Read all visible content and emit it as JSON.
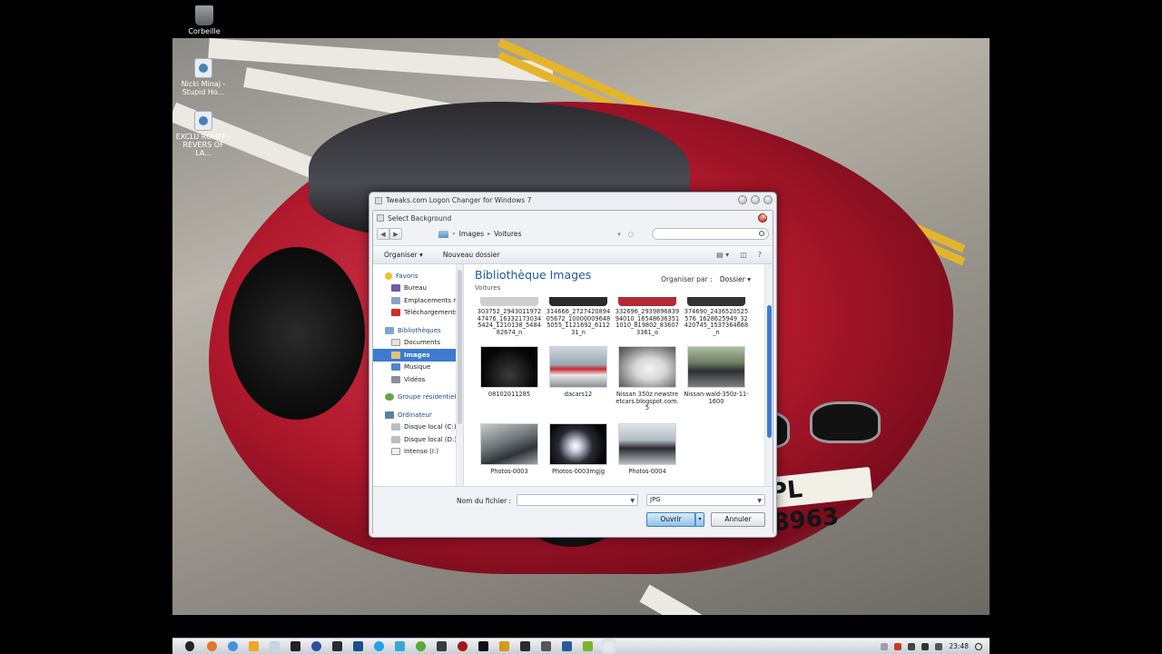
{
  "desktop": {
    "icons": [
      {
        "label": "Corbeille",
        "icon": "recycle-bin-icon"
      },
      {
        "label": "Nicki Minaj - Stupid Ho...",
        "icon": "media-file-icon"
      },
      {
        "label": "EXCLU ROHFF - REVERS OF LA...",
        "icon": "media-file-icon"
      }
    ],
    "plate_text": "PL 8963"
  },
  "outer_window": {
    "title": "Tweaks.com Logon Changer for Windows 7"
  },
  "dialog": {
    "title": "Select Background",
    "breadcrumb": [
      "Images",
      "Voitures"
    ],
    "search_placeholder": "",
    "toolbar": {
      "organize": "Organiser",
      "new_folder": "Nouveau dossier",
      "view_icon": "view-options-icon",
      "preview_icon": "preview-pane-icon",
      "help_icon": "help-icon"
    },
    "nav": {
      "favorites": {
        "label": "Favoris",
        "items": [
          "Bureau",
          "Emplacements ré",
          "Téléchargements"
        ]
      },
      "libraries": {
        "label": "Bibliothèques",
        "items": [
          "Documents",
          "Images",
          "Musique",
          "Vidéos"
        ],
        "selected": "Images"
      },
      "homegroup": {
        "label": "Groupe résidentiel"
      },
      "computer": {
        "label": "Ordinateur",
        "items": [
          "Disque local (C:)",
          "Disque local (D:)",
          "Intenso (I:)"
        ]
      }
    },
    "library": {
      "title": "Bibliothèque Images",
      "subtitle": "Voitures",
      "arrange_label": "Organiser par :",
      "arrange_value": "Dossier"
    },
    "files_row1": [
      "303752_294301197247476_163321730345424_1210138_548482674_n",
      "314666_272742089405672_100000096485055_1121692_611231_n",
      "332696_293989683994010_165486363511010_819802_836073361_o",
      "374690_2436520525576_1628625949_32420745_1537364668_n"
    ],
    "files_row2": [
      "08102011285",
      "dacars12",
      "Nissan 350z newstreetcars.blogspot.com.5",
      "Nissan-wald-350z-11-1600"
    ],
    "files_row3": [
      "Photos-0003",
      "Photos-0003mgjg",
      "Photos-0004"
    ],
    "filename_label": "Nom du fichier :",
    "filename_value": "",
    "filetype_value": "JPG",
    "open_button": "Ouvrir",
    "cancel_button": "Annuler"
  },
  "taskbar": {
    "clock": "23:48"
  }
}
